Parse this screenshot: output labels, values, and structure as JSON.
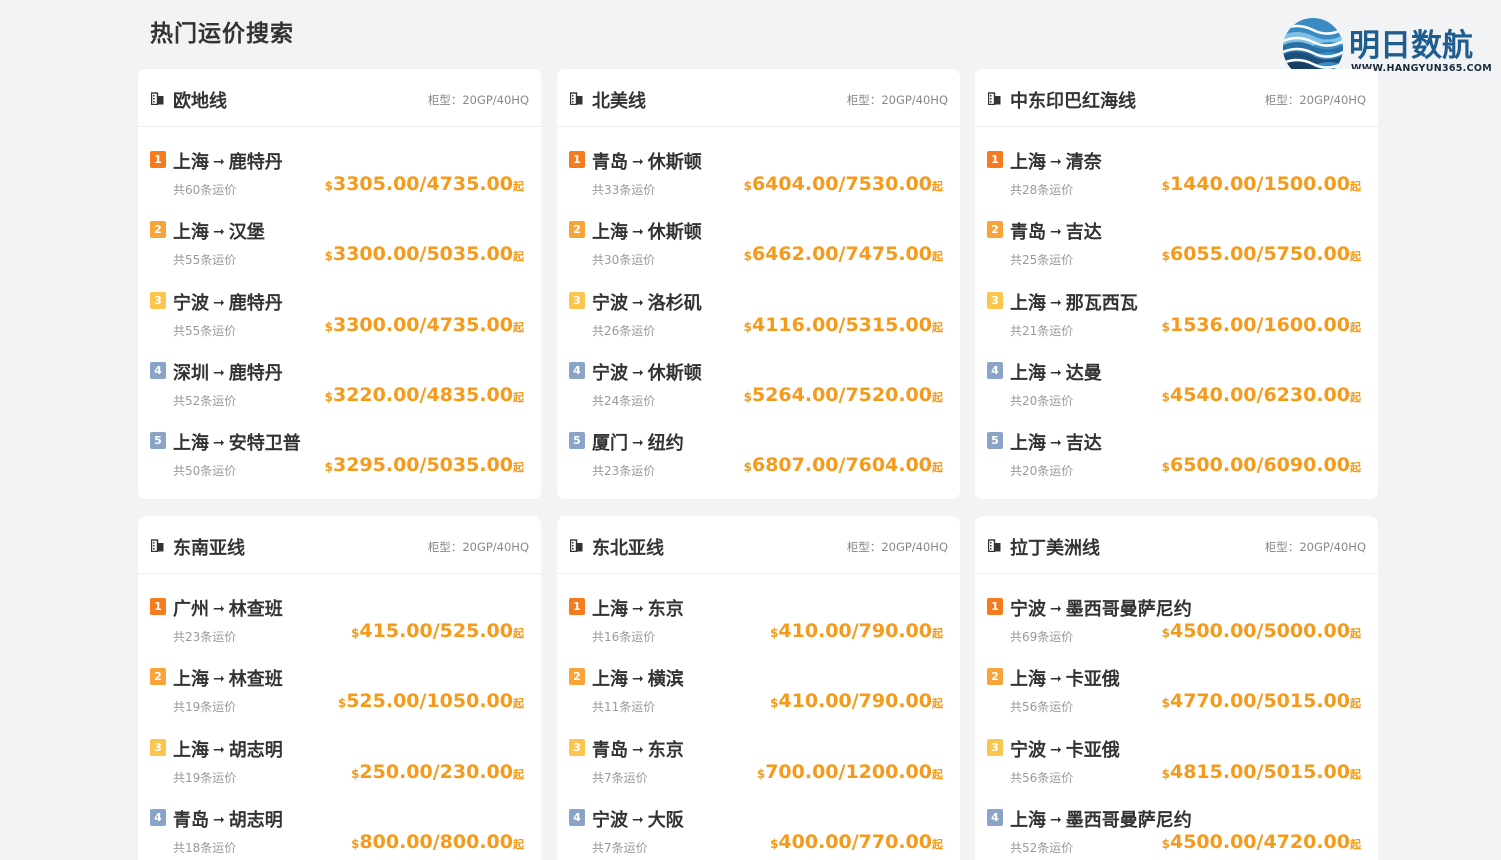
{
  "page": {
    "title": "热门运价搜索"
  },
  "logo": {
    "name": "明日数航",
    "url": "WWW.HANGYUN365.COM"
  },
  "colors": {
    "accent": "#f59a1b",
    "rank_top": "#f57b1f",
    "brand": "#1f5d8f"
  },
  "spec_label": "柜型：",
  "spec_value": "20GP/40HQ",
  "currency": "$",
  "suffix": "起",
  "cards": [
    {
      "title": "欧地线",
      "items": [
        {
          "rank": "1",
          "from": "上海",
          "to": "鹿特丹",
          "count": "共60条运价",
          "price": "3305.00/4735.00"
        },
        {
          "rank": "2",
          "from": "上海",
          "to": "汉堡",
          "count": "共55条运价",
          "price": "3300.00/5035.00"
        },
        {
          "rank": "3",
          "from": "宁波",
          "to": "鹿特丹",
          "count": "共55条运价",
          "price": "3300.00/4735.00"
        },
        {
          "rank": "4",
          "from": "深圳",
          "to": "鹿特丹",
          "count": "共52条运价",
          "price": "3220.00/4835.00"
        },
        {
          "rank": "5",
          "from": "上海",
          "to": "安特卫普",
          "count": "共50条运价",
          "price": "3295.00/5035.00"
        }
      ]
    },
    {
      "title": "北美线",
      "items": [
        {
          "rank": "1",
          "from": "青岛",
          "to": "休斯顿",
          "count": "共33条运价",
          "price": "6404.00/7530.00"
        },
        {
          "rank": "2",
          "from": "上海",
          "to": "休斯顿",
          "count": "共30条运价",
          "price": "6462.00/7475.00"
        },
        {
          "rank": "3",
          "from": "宁波",
          "to": "洛杉矶",
          "count": "共26条运价",
          "price": "4116.00/5315.00"
        },
        {
          "rank": "4",
          "from": "宁波",
          "to": "休斯顿",
          "count": "共24条运价",
          "price": "5264.00/7520.00"
        },
        {
          "rank": "5",
          "from": "厦门",
          "to": "纽约",
          "count": "共23条运价",
          "price": "6807.00/7604.00"
        }
      ]
    },
    {
      "title": "中东印巴红海线",
      "items": [
        {
          "rank": "1",
          "from": "上海",
          "to": "清奈",
          "count": "共28条运价",
          "price": "1440.00/1500.00"
        },
        {
          "rank": "2",
          "from": "青岛",
          "to": "吉达",
          "count": "共25条运价",
          "price": "6055.00/5750.00"
        },
        {
          "rank": "3",
          "from": "上海",
          "to": "那瓦西瓦",
          "count": "共21条运价",
          "price": "1536.00/1600.00"
        },
        {
          "rank": "4",
          "from": "上海",
          "to": "达曼",
          "count": "共20条运价",
          "price": "4540.00/6230.00"
        },
        {
          "rank": "5",
          "from": "上海",
          "to": "吉达",
          "count": "共20条运价",
          "price": "6500.00/6090.00"
        }
      ]
    },
    {
      "title": "东南亚线",
      "items": [
        {
          "rank": "1",
          "from": "广州",
          "to": "林查班",
          "count": "共23条运价",
          "price": "415.00/525.00"
        },
        {
          "rank": "2",
          "from": "上海",
          "to": "林查班",
          "count": "共19条运价",
          "price": "525.00/1050.00"
        },
        {
          "rank": "3",
          "from": "上海",
          "to": "胡志明",
          "count": "共19条运价",
          "price": "250.00/230.00"
        },
        {
          "rank": "4",
          "from": "青岛",
          "to": "胡志明",
          "count": "共18条运价",
          "price": "800.00/800.00"
        }
      ]
    },
    {
      "title": "东北亚线",
      "items": [
        {
          "rank": "1",
          "from": "上海",
          "to": "东京",
          "count": "共16条运价",
          "price": "410.00/790.00"
        },
        {
          "rank": "2",
          "from": "上海",
          "to": "横滨",
          "count": "共11条运价",
          "price": "410.00/790.00"
        },
        {
          "rank": "3",
          "from": "青岛",
          "to": "东京",
          "count": "共7条运价",
          "price": "700.00/1200.00"
        },
        {
          "rank": "4",
          "from": "宁波",
          "to": "大阪",
          "count": "共7条运价",
          "price": "400.00/770.00"
        }
      ]
    },
    {
      "title": "拉丁美洲线",
      "items": [
        {
          "rank": "1",
          "from": "宁波",
          "to": "墨西哥曼萨尼约",
          "count": "共69条运价",
          "price": "4500.00/5000.00"
        },
        {
          "rank": "2",
          "from": "上海",
          "to": "卡亚俄",
          "count": "共56条运价",
          "price": "4770.00/5015.00"
        },
        {
          "rank": "3",
          "from": "宁波",
          "to": "卡亚俄",
          "count": "共56条运价",
          "price": "4815.00/5015.00"
        },
        {
          "rank": "4",
          "from": "上海",
          "to": "墨西哥曼萨尼约",
          "count": "共52条运价",
          "price": "4500.00/4720.00"
        }
      ]
    }
  ]
}
